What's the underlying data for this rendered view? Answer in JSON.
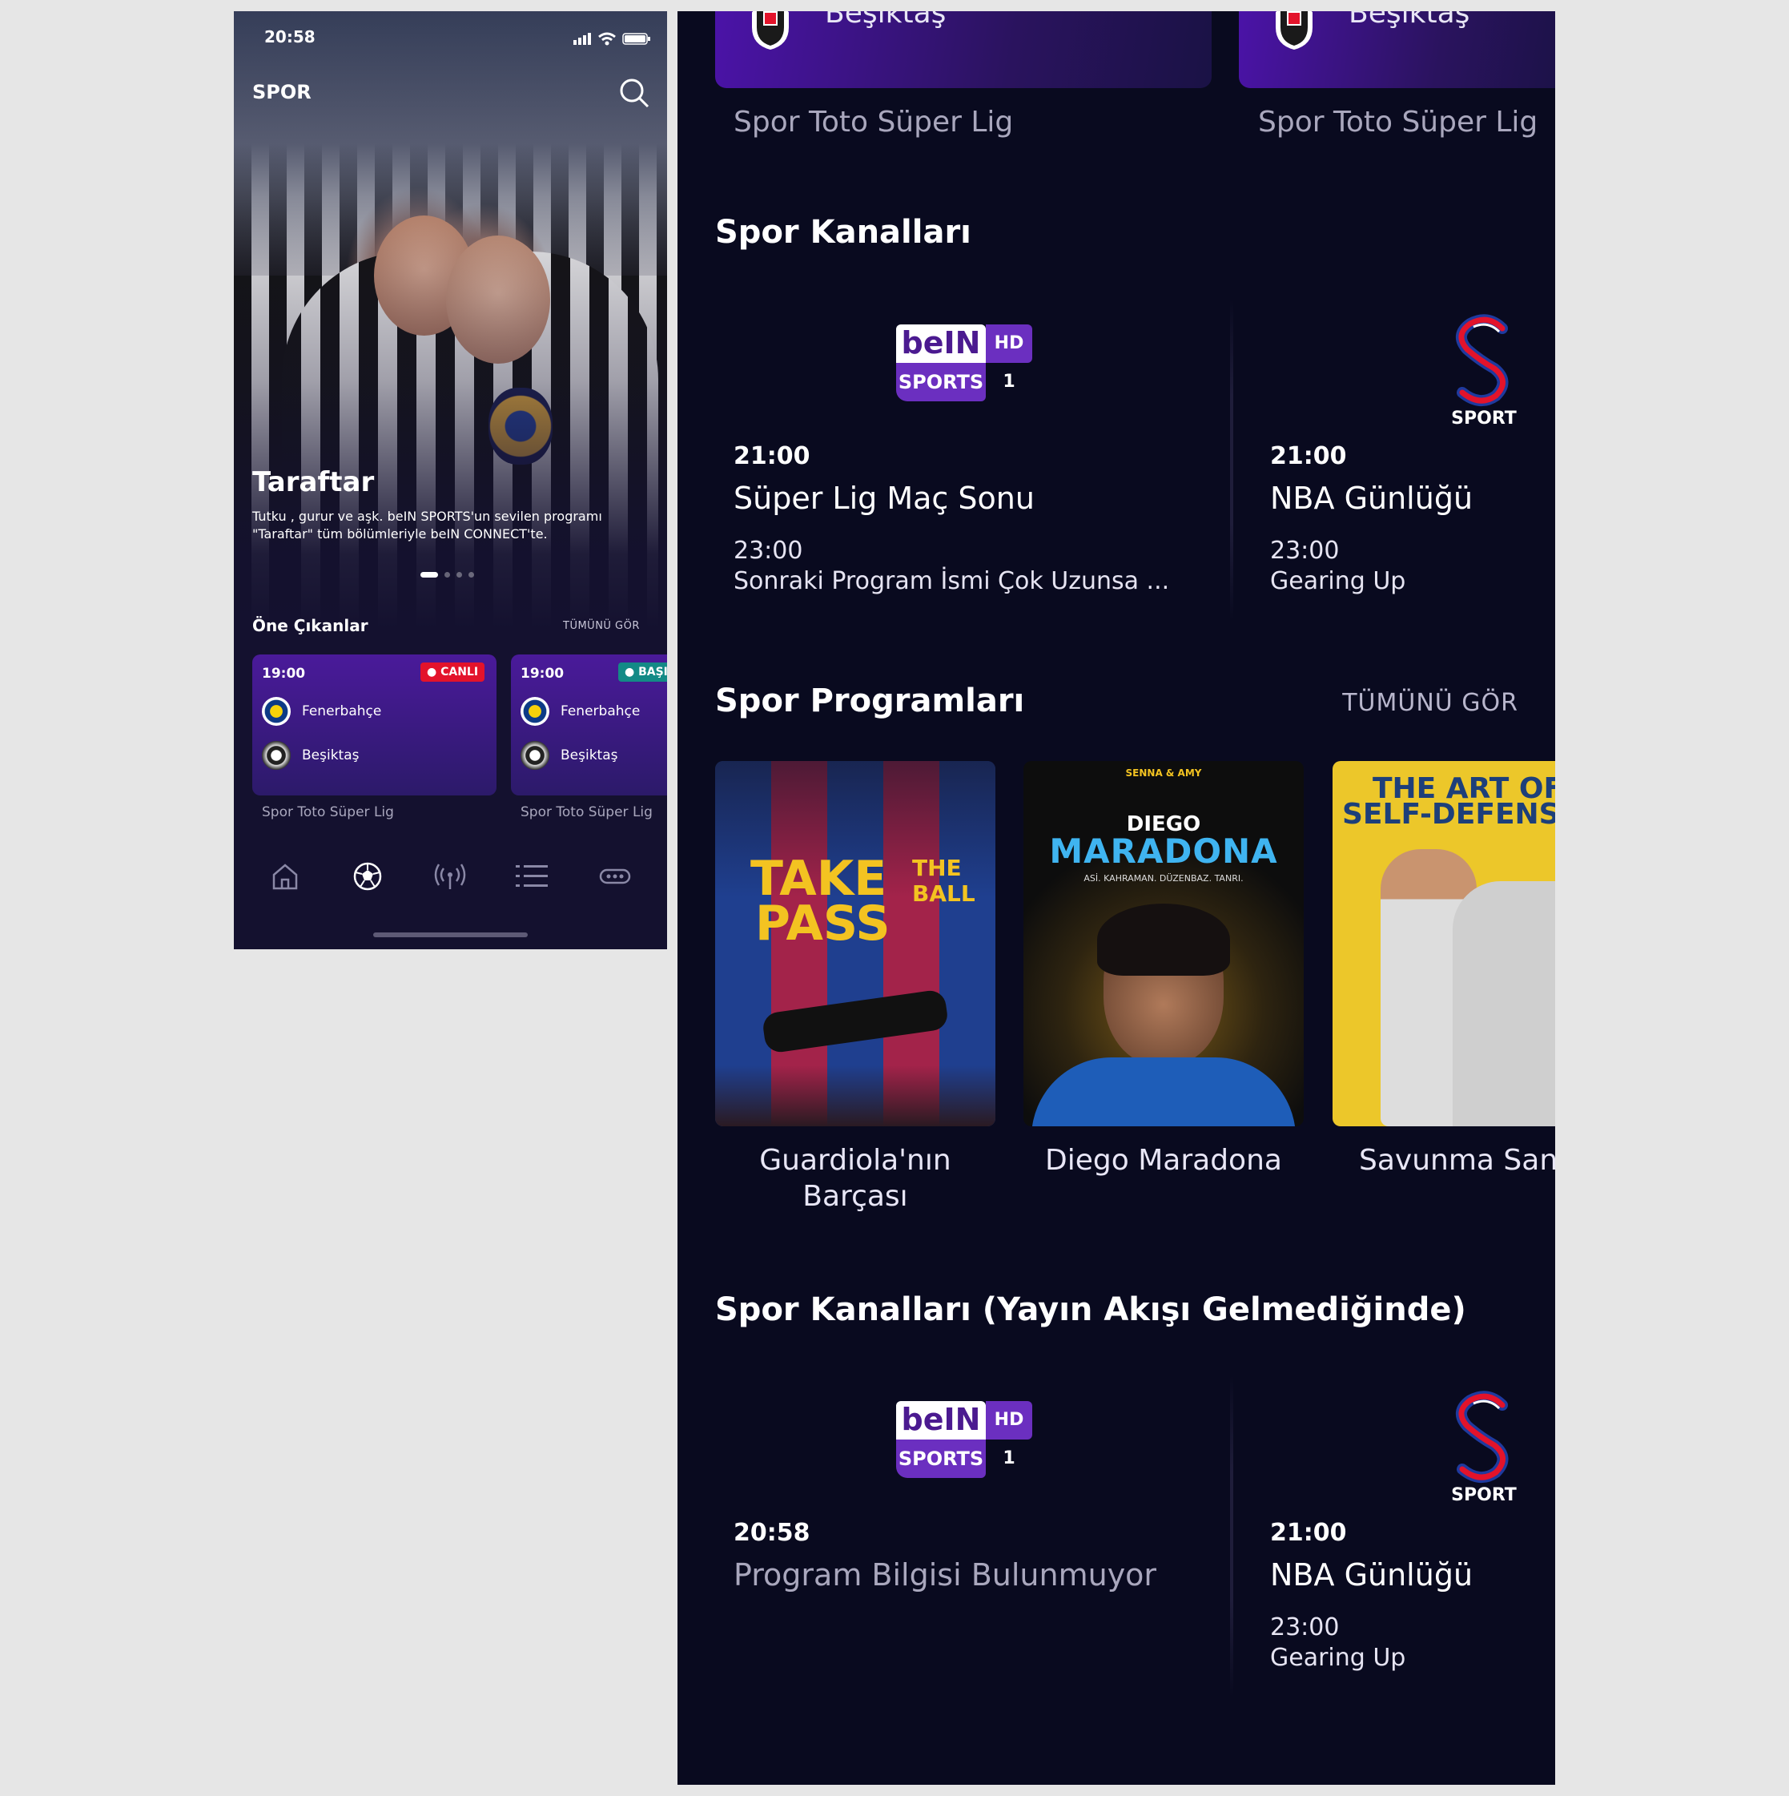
{
  "phone": {
    "status_time": "20:58",
    "header_title": "SPOR",
    "hero": {
      "title": "Taraftar",
      "description": "Tutku , gurur ve aşk. beIN SPORTS'un sevilen programı \"Taraftar\" tüm bölümleriyle beIN CONNECT'te.",
      "slide_count": 4,
      "active_slide": 1
    },
    "featured": {
      "title": "Öne Çıkanlar",
      "see_all": "TÜMÜNÜ GÖR",
      "matches": [
        {
          "time": "19:00",
          "badge": "● CANLI",
          "badge_color": "#e3132b",
          "home": "Fenerbahçe",
          "away": "Beşiktaş",
          "league": "Spor Toto Süper Lig"
        },
        {
          "time": "19:00",
          "badge": "● BAŞI",
          "badge_color": "#138a86",
          "home": "Fenerbahçe",
          "away": "Beşiktaş",
          "league": "Spor Toto Süper Lig"
        }
      ]
    },
    "tabbar": [
      "home-icon",
      "football-icon",
      "broadcast-icon",
      "list-icon",
      "more-icon"
    ],
    "active_tab": "football-icon"
  },
  "panel": {
    "top_cards": [
      {
        "team": "Beşiktaş",
        "league": "Spor Toto Süper Lig"
      },
      {
        "team": "Beşiktaş",
        "league": "Spor Toto Süper Lig"
      }
    ],
    "channels": {
      "title": "Spor Kanalları",
      "items": [
        {
          "logo": "bein-sports-hd1",
          "logo_text": {
            "brand": "beIN",
            "hd": "HD 1",
            "sports": "SPORTS"
          },
          "time": "21:00",
          "program": "Süper Lig Maç Sonu",
          "next_time": "23:00",
          "next_program": "Sonraki Program İsmi Çok Uzunsa ..."
        },
        {
          "logo": "s-sport",
          "logo_text": {
            "label": "SPORT"
          },
          "time": "21:00",
          "program": "NBA Günlüğü",
          "next_time": "23:00",
          "next_program": "Gearing Up"
        }
      ]
    },
    "programs": {
      "title": "Spor Programları",
      "see_all": "TÜMÜNÜ GÖR",
      "items": [
        {
          "title": "Guardiola'nın Barçası",
          "poster_text": {
            "line1": "TAKE",
            "line2": "PASS",
            "side": "THE BALL"
          }
        },
        {
          "title": "Diego Maradona",
          "poster_text": {
            "top": "SENNA & AMY",
            "name1": "DIEGO",
            "name2": "MARADONA",
            "tagline": "ASİ. KAHRAMAN. DÜZENBAZ. TANRI."
          }
        },
        {
          "title": "Savunma Sanatı",
          "poster_text": {
            "line1": "THE ART OF",
            "line2": "SELF-DEFENSE"
          }
        }
      ]
    },
    "channels_noepg": {
      "title": "Spor Kanalları (Yayın Akışı Gelmediğinde)",
      "items": [
        {
          "logo": "bein-sports-hd1",
          "logo_text": {
            "brand": "beIN",
            "hd": "HD 1",
            "sports": "SPORTS"
          },
          "time": "20:58",
          "program": "Program Bilgisi Bulunmuyor"
        },
        {
          "logo": "s-sport",
          "logo_text": {
            "label": "SPORT"
          },
          "time": "21:00",
          "program": "NBA Günlüğü",
          "next_time": "23:00",
          "next_program": "Gearing Up"
        }
      ]
    }
  },
  "colors": {
    "accent_purple": "#4b13a8",
    "background_dark": "#090a1f",
    "live_red": "#e3132b"
  }
}
